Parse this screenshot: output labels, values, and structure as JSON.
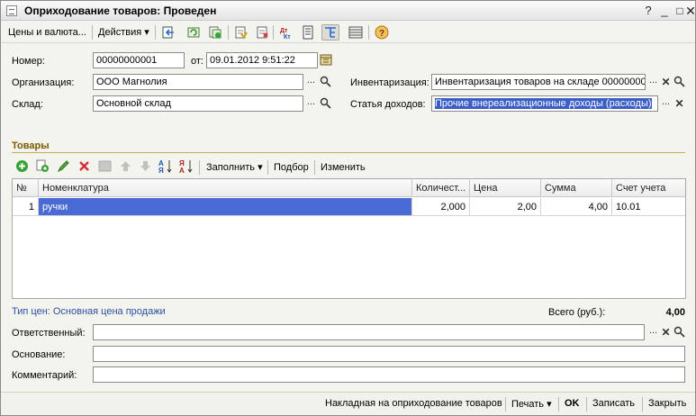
{
  "window": {
    "title": "Оприходование товаров: Проведен"
  },
  "toolbar": {
    "prices_label": "Цены и валюта...",
    "actions_label": "Действия"
  },
  "header": {
    "number_label": "Номер:",
    "number_value": "00000000001",
    "date_label": "от:",
    "date_value": "09.01.2012  9:51:22",
    "org_label": "Организация:",
    "org_value": "ООО Магнолия",
    "warehouse_label": "Склад:",
    "warehouse_value": "Основной склад",
    "inventory_label": "Инвентаризация:",
    "inventory_value": "Инвентаризация товаров на складе 00000000",
    "income_label": "Статья доходов:",
    "income_value": "Прочие внереализационные доходы (расходы)"
  },
  "goods": {
    "section_title": "Товары",
    "fill_label": "Заполнить",
    "pick_label": "Подбор",
    "change_label": "Изменить",
    "columns": [
      "№",
      "Номенклатура",
      "Количест...",
      "Цена",
      "Сумма",
      "Счет учета"
    ],
    "rows": [
      {
        "n": "1",
        "name": "ручки",
        "qty": "2,000",
        "price": "2,00",
        "sum": "4,00",
        "account": "10.01"
      }
    ]
  },
  "footer": {
    "price_type": "Тип цен: Основная цена продажи",
    "total_label": "Всего (руб.):",
    "total_value": "4,00",
    "responsible_label": "Ответственный:",
    "basis_label": "Основание:",
    "comment_label": "Комментарий:",
    "responsible_value": "",
    "basis_value": "",
    "comment_value": ""
  },
  "bottom": {
    "invoice_label": "Накладная на оприходование товаров",
    "print_label": "Печать",
    "ok_label": "OK",
    "save_label": "Записать",
    "close_label": "Закрыть"
  },
  "colors": {
    "selection": "#3a5ec6",
    "section": "#7a5a00",
    "link": "#2b4fa0"
  }
}
